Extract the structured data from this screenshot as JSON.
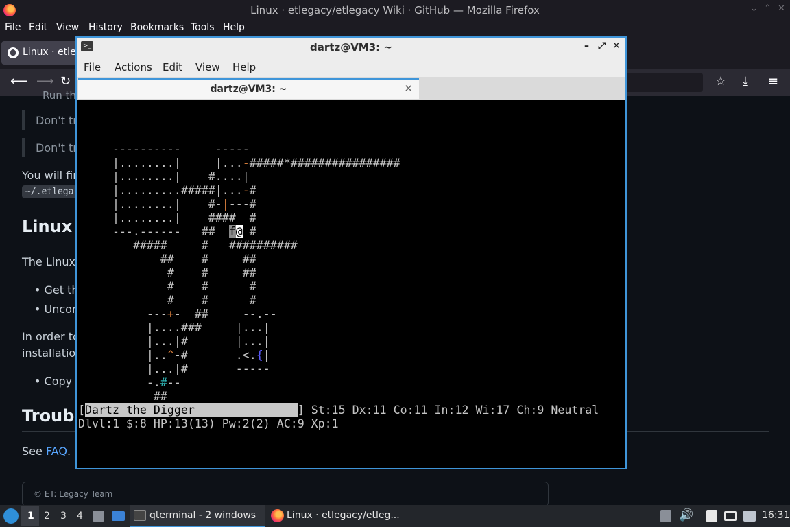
{
  "firefox": {
    "window_title": "Linux · etlegacy/etlegacy Wiki · GitHub — Mozilla Firefox",
    "menu": [
      "File",
      "Edit",
      "View",
      "History",
      "Bookmarks",
      "Tools",
      "Help"
    ],
    "tab_label": "Linux · etleg",
    "content": {
      "partial_top": "Run th",
      "quote1": "Don't try",
      "quote2": "Don't try",
      "para1_start": "You will find",
      "code_path": "~/.etlega",
      "heading1": "Linux A",
      "para2": "The Linux a",
      "bullet1": "Get the",
      "bullet2": "Uncom",
      "para3_line1": "In order to",
      "para3_line2": "installation.",
      "bullet3": "Copy t",
      "heading2": "Trouble",
      "see_text": "See ",
      "faq_link": "FAQ",
      "see_end": ".",
      "footer": "© ET: Legacy Team"
    }
  },
  "qterminal": {
    "window_title": "dartz@VM3: ~",
    "menu": [
      "File",
      "Actions",
      "Edit",
      "View",
      "Help"
    ],
    "tab_title": "dartz@VM3: ~",
    "status_name": "Dartz the Digger",
    "status_stats": "] St:15 Dx:11 Co:11 In:12 Wi:17 Ch:9 Neutral",
    "status_line2": "Dlvl:1 $:8 HP:13(13) Pw:2(2) AC:9 Xp:1"
  },
  "taskbar": {
    "workspaces": [
      "1",
      "2",
      "3",
      "4"
    ],
    "active_workspace": "1",
    "task_terminal": "qterminal - 2 windows",
    "task_firefox": "Linux · etlegacy/etleg...",
    "clock": "16:31"
  },
  "colors": {
    "accent": "#3f95d9",
    "terminal_bg": "#000000",
    "github_bg": "#0d1117",
    "link": "#58a6ff"
  }
}
